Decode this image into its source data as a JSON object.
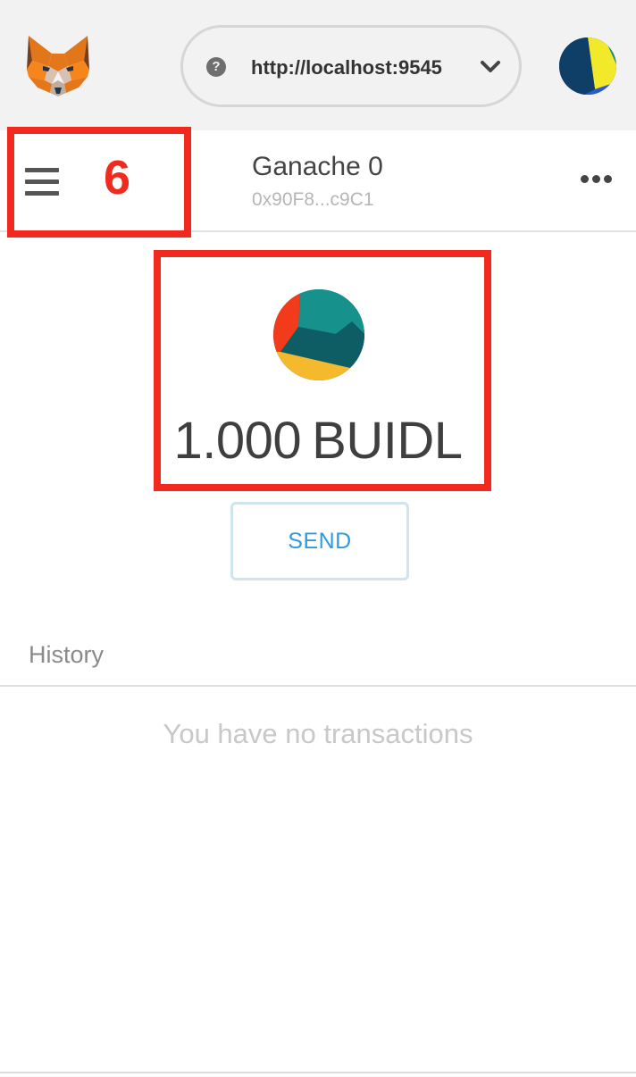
{
  "header": {
    "logo_icon": "metamask-fox-icon",
    "network": {
      "help_icon": "question-mark-icon",
      "help_glyph": "?",
      "url": "http://localhost:9545",
      "dropdown_icon": "chevron-down-icon"
    },
    "account_avatar_icon": "identicon-avatar"
  },
  "account": {
    "menu_icon": "hamburger-menu-icon",
    "name": "Ganache 0",
    "address": "0x90F8...c9C1",
    "options_icon": "more-options-icon"
  },
  "annotations": {
    "menu_label": "6",
    "color": "#f02a1f"
  },
  "balance": {
    "token_icon": "token-identicon",
    "amount": "1.000",
    "symbol": "BUIDL"
  },
  "actions": {
    "send_label": "SEND"
  },
  "history": {
    "title": "History",
    "empty_message": "You have no transactions"
  },
  "colors": {
    "header_bg": "#f2f2f2",
    "send_text": "#2f9ae0",
    "send_border": "#cfe4ef"
  }
}
